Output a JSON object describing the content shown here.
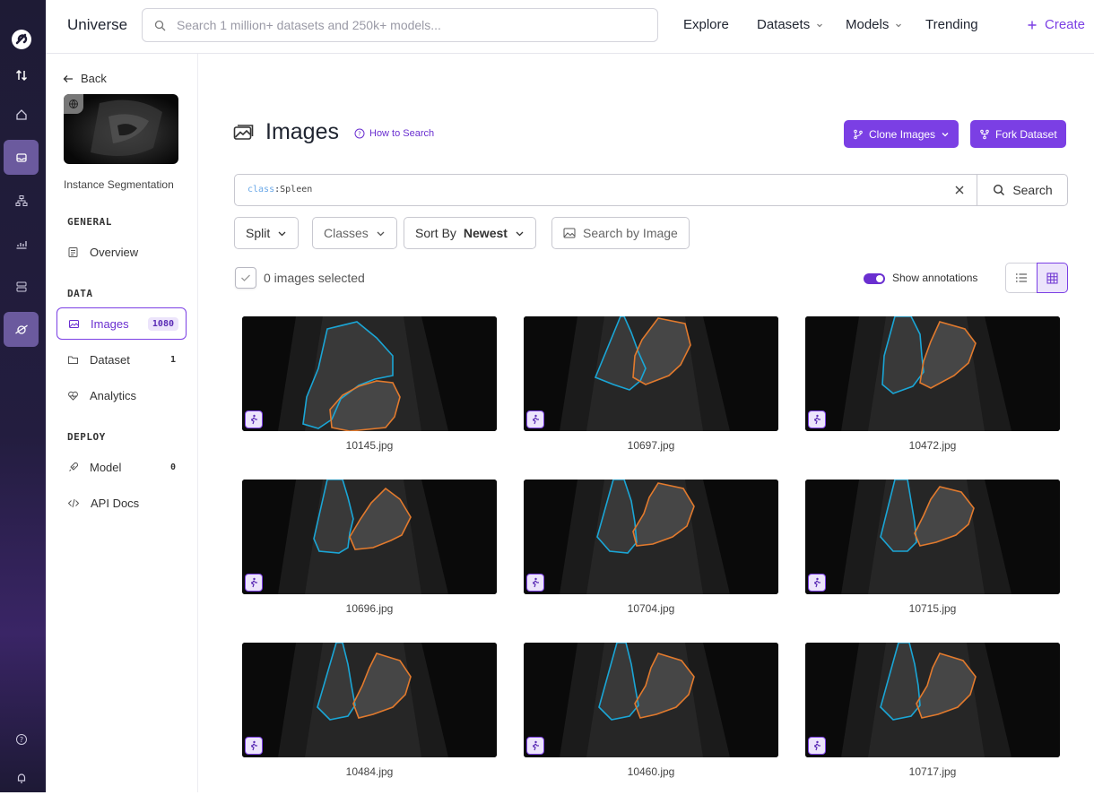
{
  "topbar": {
    "brand": "Universe",
    "search_placeholder": "Search 1 million+ datasets and 250k+ models...",
    "nav": {
      "explore": "Explore",
      "datasets": "Datasets",
      "models": "Models",
      "trending": "Trending",
      "create": "Create"
    }
  },
  "sidebar": {
    "back": "Back",
    "project_type": "Instance Segmentation",
    "sections": {
      "general": "GENERAL",
      "data": "DATA",
      "deploy": "DEPLOY"
    },
    "items": {
      "overview": {
        "label": "Overview"
      },
      "images": {
        "label": "Images",
        "count": "1080"
      },
      "dataset": {
        "label": "Dataset",
        "count": "1"
      },
      "analytics": {
        "label": "Analytics"
      },
      "model": {
        "label": "Model",
        "count": "0"
      },
      "api_docs": {
        "label": "API Docs"
      }
    }
  },
  "main": {
    "title": "Images",
    "how_to_search": "How to Search",
    "clone_images": "Clone Images",
    "fork_dataset": "Fork Dataset",
    "query": {
      "key": "class",
      "sep": ":",
      "value": "Spleen"
    },
    "search_button": "Search",
    "filters": {
      "split": "Split",
      "classes": "Classes",
      "sort_label": "Sort By",
      "sort_value": "Newest",
      "search_by_image": "Search by Image"
    },
    "selected_text": "0 images selected",
    "show_annotations": "Show annotations",
    "show_annotations_on": true
  },
  "images": [
    {
      "filename": "10145.jpg"
    },
    {
      "filename": "10697.jpg"
    },
    {
      "filename": "10472.jpg"
    },
    {
      "filename": "10696.jpg"
    },
    {
      "filename": "10704.jpg"
    },
    {
      "filename": "10715.jpg"
    },
    {
      "filename": "10484.jpg"
    },
    {
      "filename": "10460.jpg"
    },
    {
      "filename": "10717.jpg"
    }
  ],
  "colors": {
    "accent": "#7b3fe4",
    "annotation_blue": "#1aa6d6",
    "annotation_orange": "#e27a2d"
  }
}
